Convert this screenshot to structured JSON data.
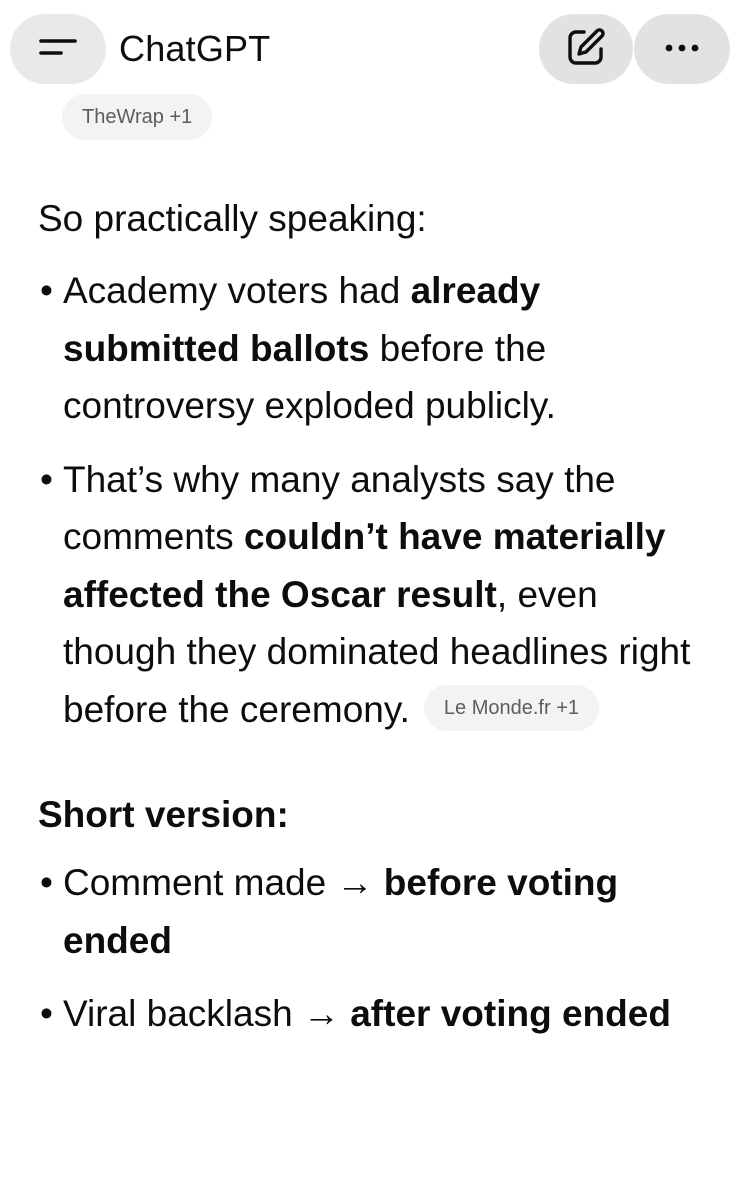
{
  "header": {
    "title": "ChatGPT",
    "menu_icon": "menu-icon",
    "edit_icon": "edit-icon",
    "more_icon": "more-dots-icon"
  },
  "source_chip_top": "TheWrap +1",
  "intro": "So practically speaking:",
  "bullets1": [
    {
      "segments": [
        {
          "text": "Academy voters had ",
          "bold": false
        },
        {
          "text": "already submitted ballots",
          "bold": true
        },
        {
          "text": " before the controversy exploded publicly.",
          "bold": false
        }
      ]
    },
    {
      "segments": [
        {
          "text": "That’s why many analysts say the comments ",
          "bold": false
        },
        {
          "text": "couldn’t have materially affected the Oscar result",
          "bold": true
        },
        {
          "text": ", even though they dominated headlines right before the ceremony.",
          "bold": false
        }
      ],
      "source_chip": "Le Monde.fr +1"
    }
  ],
  "short_heading": "Short version:",
  "bullets2": [
    {
      "segments": [
        {
          "text": "Comment made → ",
          "bold": false
        },
        {
          "text": "before voting ended",
          "bold": true
        }
      ]
    },
    {
      "segments": [
        {
          "text": "Viral backlash → ",
          "bold": false
        },
        {
          "text": "after voting ended",
          "bold": true
        }
      ]
    }
  ],
  "bullet_char": "•",
  "colors": {
    "text": "#0d0d0d",
    "chip_bg": "#f3f3f3",
    "chip_text": "#5d5d5d",
    "button_bg": "#e2e2e2"
  }
}
